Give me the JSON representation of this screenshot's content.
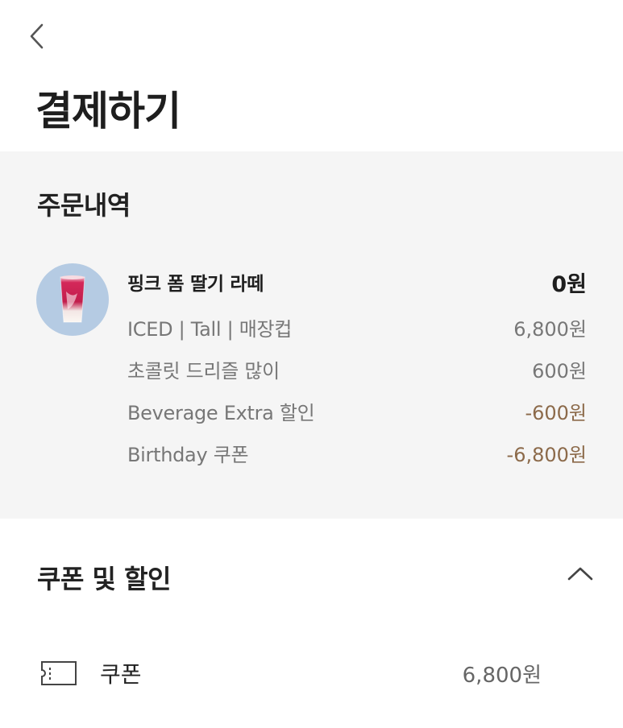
{
  "header": {
    "back_icon": "chevron-left-icon",
    "title": "결제하기"
  },
  "order": {
    "section_title": "주문내역",
    "product": {
      "name": "핑크 폼 딸기 라떼",
      "price": "0원",
      "thumbnail_colors": {
        "background": "#b5cbe3",
        "drink": "#c8224f"
      }
    },
    "options": [
      {
        "label": "ICED | Tall | 매장컵",
        "amount": "6,800원",
        "discount": false
      },
      {
        "label": "초콜릿 드리즐 많이",
        "amount": "600원",
        "discount": false
      },
      {
        "label": "Beverage Extra 할인",
        "amount": "-600원",
        "discount": true
      },
      {
        "label": "Birthday 쿠폰",
        "amount": "-6,800원",
        "discount": true
      }
    ]
  },
  "coupons": {
    "section_title": "쿠폰 및 할인",
    "toggle_icon": "chevron-up-icon",
    "coupon_row": {
      "icon": "ticket-icon",
      "label": "쿠폰",
      "amount": "6,800원"
    }
  },
  "colors": {
    "accent_discount": "#8c6a4a",
    "section_bg": "#f5f5f5",
    "text_primary": "#1e1e1e",
    "text_secondary": "#777777"
  }
}
